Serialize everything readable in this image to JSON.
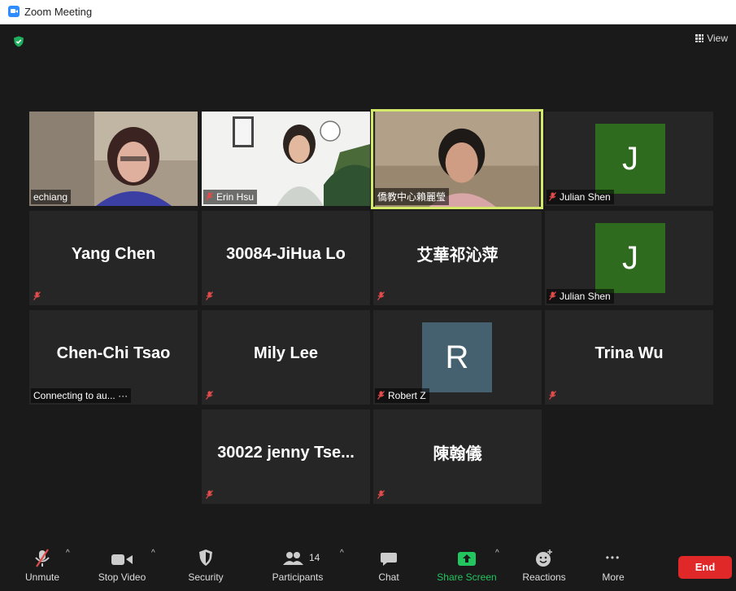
{
  "window": {
    "title": "Zoom Meeting"
  },
  "header": {
    "view_label": "View"
  },
  "tiles": [
    {
      "name": "echiang"
    },
    {
      "name": "Erin Hsu"
    },
    {
      "name": "僑教中心賴麗瑩"
    },
    {
      "name": "Julian Shen",
      "initial": "J"
    },
    {
      "name": "Yang Chen"
    },
    {
      "name": "30084-JiHua Lo"
    },
    {
      "name": "艾華祁沁萍"
    },
    {
      "name": "Julian Shen",
      "initial": "J"
    },
    {
      "name": "Chen-Chi Tsao",
      "status": "Connecting to au...",
      "dots": "···"
    },
    {
      "name": "Mily Lee"
    },
    {
      "name": "Robert Z",
      "initial": "R"
    },
    {
      "name": "Trina Wu"
    },
    {
      "name": "30022 jenny Tse..."
    },
    {
      "name": "陳翰儀"
    }
  ],
  "toolbar": {
    "unmute": "Unmute",
    "stop_video": "Stop Video",
    "security": "Security",
    "participants": "Participants",
    "participants_count": "14",
    "chat": "Chat",
    "share_screen": "Share Screen",
    "reactions": "Reactions",
    "more": "More",
    "end": "End",
    "caret": "^",
    "more_dots": "•••"
  },
  "colors": {
    "avatar_green": "#2f6b1f",
    "avatar_slate": "#45606e",
    "active_speaker_border": "#d4e86a",
    "share_green": "#22c55e",
    "end_red": "#e02828"
  }
}
